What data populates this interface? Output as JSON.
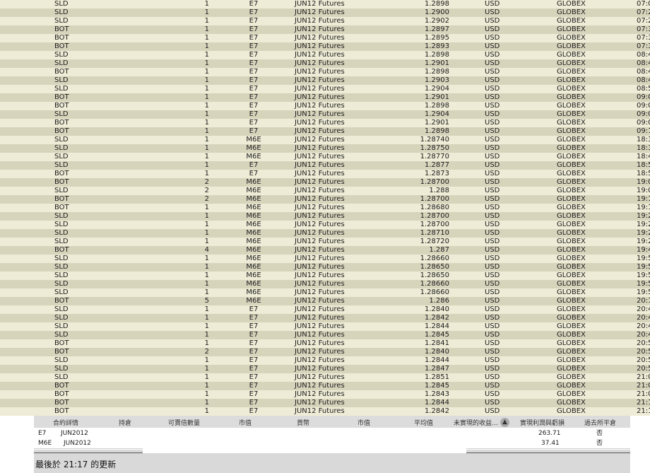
{
  "trades": [
    {
      "action": "SLD",
      "qty": "1",
      "symbol": "E7",
      "desc": "JUN12 Futures",
      "price": "1.2898",
      "currency": "USD",
      "exchange": "GLOBEX",
      "time": "07:0"
    },
    {
      "action": "SLD",
      "qty": "1",
      "symbol": "E7",
      "desc": "JUN12 Futures",
      "price": "1.2900",
      "currency": "USD",
      "exchange": "GLOBEX",
      "time": "07:2"
    },
    {
      "action": "SLD",
      "qty": "1",
      "symbol": "E7",
      "desc": "JUN12 Futures",
      "price": "1.2902",
      "currency": "USD",
      "exchange": "GLOBEX",
      "time": "07:2"
    },
    {
      "action": "BOT",
      "qty": "1",
      "symbol": "E7",
      "desc": "JUN12 Futures",
      "price": "1.2897",
      "currency": "USD",
      "exchange": "GLOBEX",
      "time": "07:3"
    },
    {
      "action": "BOT",
      "qty": "1",
      "symbol": "E7",
      "desc": "JUN12 Futures",
      "price": "1.2895",
      "currency": "USD",
      "exchange": "GLOBEX",
      "time": "07:3"
    },
    {
      "action": "BOT",
      "qty": "1",
      "symbol": "E7",
      "desc": "JUN12 Futures",
      "price": "1.2893",
      "currency": "USD",
      "exchange": "GLOBEX",
      "time": "07:3"
    },
    {
      "action": "SLD",
      "qty": "1",
      "symbol": "E7",
      "desc": "JUN12 Futures",
      "price": "1.2898",
      "currency": "USD",
      "exchange": "GLOBEX",
      "time": "08:4"
    },
    {
      "action": "SLD",
      "qty": "1",
      "symbol": "E7",
      "desc": "JUN12 Futures",
      "price": "1.2901",
      "currency": "USD",
      "exchange": "GLOBEX",
      "time": "08:4"
    },
    {
      "action": "BOT",
      "qty": "1",
      "symbol": "E7",
      "desc": "JUN12 Futures",
      "price": "1.2898",
      "currency": "USD",
      "exchange": "GLOBEX",
      "time": "08:4"
    },
    {
      "action": "SLD",
      "qty": "1",
      "symbol": "E7",
      "desc": "JUN12 Futures",
      "price": "1.2903",
      "currency": "USD",
      "exchange": "GLOBEX",
      "time": "08:4"
    },
    {
      "action": "SLD",
      "qty": "1",
      "symbol": "E7",
      "desc": "JUN12 Futures",
      "price": "1.2904",
      "currency": "USD",
      "exchange": "GLOBEX",
      "time": "08:5"
    },
    {
      "action": "BOT",
      "qty": "1",
      "symbol": "E7",
      "desc": "JUN12 Futures",
      "price": "1.2901",
      "currency": "USD",
      "exchange": "GLOBEX",
      "time": "09:0"
    },
    {
      "action": "BOT",
      "qty": "1",
      "symbol": "E7",
      "desc": "JUN12 Futures",
      "price": "1.2898",
      "currency": "USD",
      "exchange": "GLOBEX",
      "time": "09:0"
    },
    {
      "action": "SLD",
      "qty": "1",
      "symbol": "E7",
      "desc": "JUN12 Futures",
      "price": "1.2904",
      "currency": "USD",
      "exchange": "GLOBEX",
      "time": "09:0"
    },
    {
      "action": "BOT",
      "qty": "1",
      "symbol": "E7",
      "desc": "JUN12 Futures",
      "price": "1.2901",
      "currency": "USD",
      "exchange": "GLOBEX",
      "time": "09:0"
    },
    {
      "action": "BOT",
      "qty": "1",
      "symbol": "E7",
      "desc": "JUN12 Futures",
      "price": "1.2898",
      "currency": "USD",
      "exchange": "GLOBEX",
      "time": "09:1"
    },
    {
      "action": "SLD",
      "qty": "1",
      "symbol": "M6E",
      "desc": "JUN12 Futures",
      "price": "1.28740",
      "currency": "USD",
      "exchange": "GLOBEX",
      "time": "18:3"
    },
    {
      "action": "SLD",
      "qty": "1",
      "symbol": "M6E",
      "desc": "JUN12 Futures",
      "price": "1.28750",
      "currency": "USD",
      "exchange": "GLOBEX",
      "time": "18:3"
    },
    {
      "action": "SLD",
      "qty": "1",
      "symbol": "M6E",
      "desc": "JUN12 Futures",
      "price": "1.28770",
      "currency": "USD",
      "exchange": "GLOBEX",
      "time": "18:4"
    },
    {
      "action": "SLD",
      "qty": "1",
      "symbol": "E7",
      "desc": "JUN12 Futures",
      "price": "1.2877",
      "currency": "USD",
      "exchange": "GLOBEX",
      "time": "18:5"
    },
    {
      "action": "BOT",
      "qty": "1",
      "symbol": "E7",
      "desc": "JUN12 Futures",
      "price": "1.2873",
      "currency": "USD",
      "exchange": "GLOBEX",
      "time": "18:5"
    },
    {
      "action": "BOT",
      "qty": "2",
      "symbol": "M6E",
      "desc": "JUN12 Futures",
      "price": "1.28700",
      "currency": "USD",
      "exchange": "GLOBEX",
      "time": "19:0"
    },
    {
      "action": "SLD",
      "qty": "2",
      "symbol": "M6E",
      "desc": "JUN12 Futures",
      "price": "1.288",
      "currency": "USD",
      "exchange": "GLOBEX",
      "time": "19:0"
    },
    {
      "action": "BOT",
      "qty": "2",
      "symbol": "M6E",
      "desc": "JUN12 Futures",
      "price": "1.28700",
      "currency": "USD",
      "exchange": "GLOBEX",
      "time": "19:1"
    },
    {
      "action": "BOT",
      "qty": "1",
      "symbol": "M6E",
      "desc": "JUN12 Futures",
      "price": "1.28680",
      "currency": "USD",
      "exchange": "GLOBEX",
      "time": "19:1"
    },
    {
      "action": "SLD",
      "qty": "1",
      "symbol": "M6E",
      "desc": "JUN12 Futures",
      "price": "1.28700",
      "currency": "USD",
      "exchange": "GLOBEX",
      "time": "19:2"
    },
    {
      "action": "SLD",
      "qty": "1",
      "symbol": "M6E",
      "desc": "JUN12 Futures",
      "price": "1.28700",
      "currency": "USD",
      "exchange": "GLOBEX",
      "time": "19:2"
    },
    {
      "action": "SLD",
      "qty": "1",
      "symbol": "M6E",
      "desc": "JUN12 Futures",
      "price": "1.28710",
      "currency": "USD",
      "exchange": "GLOBEX",
      "time": "19:2"
    },
    {
      "action": "SLD",
      "qty": "1",
      "symbol": "M6E",
      "desc": "JUN12 Futures",
      "price": "1.28720",
      "currency": "USD",
      "exchange": "GLOBEX",
      "time": "19:2"
    },
    {
      "action": "BOT",
      "qty": "4",
      "symbol": "M6E",
      "desc": "JUN12 Futures",
      "price": "1.287",
      "currency": "USD",
      "exchange": "GLOBEX",
      "time": "19:4"
    },
    {
      "action": "SLD",
      "qty": "1",
      "symbol": "M6E",
      "desc": "JUN12 Futures",
      "price": "1.28660",
      "currency": "USD",
      "exchange": "GLOBEX",
      "time": "19:5"
    },
    {
      "action": "SLD",
      "qty": "1",
      "symbol": "M6E",
      "desc": "JUN12 Futures",
      "price": "1.28650",
      "currency": "USD",
      "exchange": "GLOBEX",
      "time": "19:5"
    },
    {
      "action": "SLD",
      "qty": "1",
      "symbol": "M6E",
      "desc": "JUN12 Futures",
      "price": "1.28650",
      "currency": "USD",
      "exchange": "GLOBEX",
      "time": "19:5"
    },
    {
      "action": "SLD",
      "qty": "1",
      "symbol": "M6E",
      "desc": "JUN12 Futures",
      "price": "1.28660",
      "currency": "USD",
      "exchange": "GLOBEX",
      "time": "19:5"
    },
    {
      "action": "SLD",
      "qty": "1",
      "symbol": "M6E",
      "desc": "JUN12 Futures",
      "price": "1.28660",
      "currency": "USD",
      "exchange": "GLOBEX",
      "time": "19:5"
    },
    {
      "action": "BOT",
      "qty": "5",
      "symbol": "M6E",
      "desc": "JUN12 Futures",
      "price": "1.286",
      "currency": "USD",
      "exchange": "GLOBEX",
      "time": "20:1"
    },
    {
      "action": "SLD",
      "qty": "1",
      "symbol": "E7",
      "desc": "JUN12 Futures",
      "price": "1.2840",
      "currency": "USD",
      "exchange": "GLOBEX",
      "time": "20:4"
    },
    {
      "action": "SLD",
      "qty": "1",
      "symbol": "E7",
      "desc": "JUN12 Futures",
      "price": "1.2842",
      "currency": "USD",
      "exchange": "GLOBEX",
      "time": "20:4"
    },
    {
      "action": "SLD",
      "qty": "1",
      "symbol": "E7",
      "desc": "JUN12 Futures",
      "price": "1.2844",
      "currency": "USD",
      "exchange": "GLOBEX",
      "time": "20:4"
    },
    {
      "action": "SLD",
      "qty": "1",
      "symbol": "E7",
      "desc": "JUN12 Futures",
      "price": "1.2845",
      "currency": "USD",
      "exchange": "GLOBEX",
      "time": "20:4"
    },
    {
      "action": "BOT",
      "qty": "1",
      "symbol": "E7",
      "desc": "JUN12 Futures",
      "price": "1.2841",
      "currency": "USD",
      "exchange": "GLOBEX",
      "time": "20:5"
    },
    {
      "action": "BOT",
      "qty": "2",
      "symbol": "E7",
      "desc": "JUN12 Futures",
      "price": "1.2840",
      "currency": "USD",
      "exchange": "GLOBEX",
      "time": "20:5"
    },
    {
      "action": "SLD",
      "qty": "1",
      "symbol": "E7",
      "desc": "JUN12 Futures",
      "price": "1.2844",
      "currency": "USD",
      "exchange": "GLOBEX",
      "time": "20:5"
    },
    {
      "action": "SLD",
      "qty": "1",
      "symbol": "E7",
      "desc": "JUN12 Futures",
      "price": "1.2847",
      "currency": "USD",
      "exchange": "GLOBEX",
      "time": "20:5"
    },
    {
      "action": "SLD",
      "qty": "1",
      "symbol": "E7",
      "desc": "JUN12 Futures",
      "price": "1.2851",
      "currency": "USD",
      "exchange": "GLOBEX",
      "time": "21:0"
    },
    {
      "action": "BOT",
      "qty": "1",
      "symbol": "E7",
      "desc": "JUN12 Futures",
      "price": "1.2845",
      "currency": "USD",
      "exchange": "GLOBEX",
      "time": "21:0"
    },
    {
      "action": "BOT",
      "qty": "1",
      "symbol": "E7",
      "desc": "JUN12 Futures",
      "price": "1.2843",
      "currency": "USD",
      "exchange": "GLOBEX",
      "time": "21:0"
    },
    {
      "action": "BOT",
      "qty": "1",
      "symbol": "E7",
      "desc": "JUN12 Futures",
      "price": "1.2844",
      "currency": "USD",
      "exchange": "GLOBEX",
      "time": "21:1"
    },
    {
      "action": "BOT",
      "qty": "1",
      "symbol": "E7",
      "desc": "JUN12 Futures",
      "price": "1.2842",
      "currency": "USD",
      "exchange": "GLOBEX",
      "time": "21:1"
    }
  ],
  "portfolio": {
    "headers": {
      "contract": "合約詳情",
      "position": "持倉",
      "marketable": "可賣倍數量",
      "market_price": "市值",
      "currency": "貨幣",
      "market_value": "市值",
      "avg_price": "平均值",
      "unrealized": "未實現的收益…",
      "realized": "實現利潤與虧損",
      "closed": "過去所平倉"
    },
    "rows": [
      {
        "symbol": "E7",
        "expiry": "JUN2012",
        "realized": "263.71",
        "closed": "否"
      },
      {
        "symbol": "M6E",
        "expiry": "JUN2012",
        "realized": "37.41",
        "closed": "否"
      }
    ]
  },
  "status": {
    "text": "最後於 21:17 的更新"
  },
  "icons": {
    "scroll_button": "up-arrow-icon"
  },
  "colors": {
    "row_light": "#eeecd6",
    "row_dark": "#d7d4bc",
    "header_bg": "#dcdcdc"
  }
}
